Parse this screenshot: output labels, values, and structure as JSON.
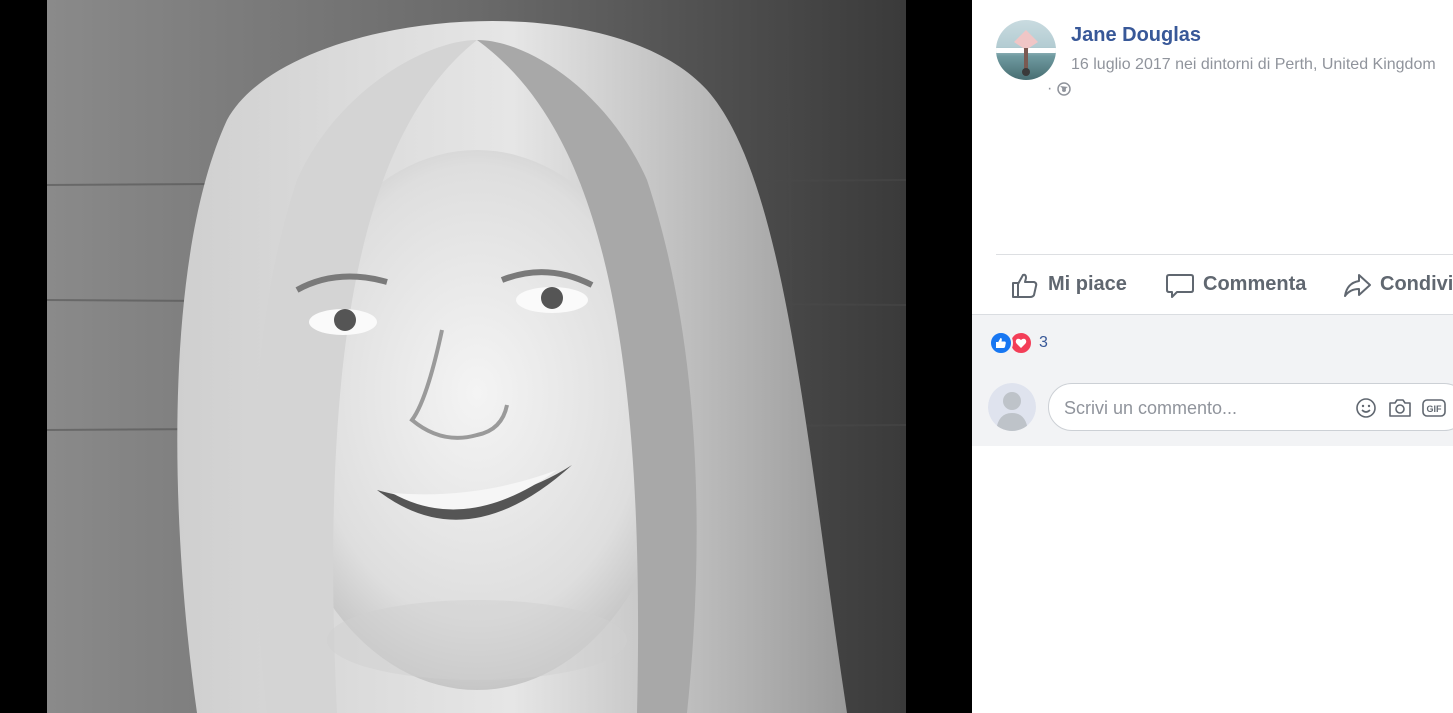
{
  "post": {
    "author": "Jane Douglas",
    "meta": "16 luglio 2017 nei dintorni di Perth, United Kingdom",
    "meta_sep": "·",
    "privacy_icon": "globe-icon"
  },
  "actions": {
    "like": "Mi piace",
    "comment": "Commenta",
    "share": "Condividi"
  },
  "reactions": {
    "types": [
      "like-icon",
      "love-icon"
    ],
    "count": "3"
  },
  "comment_input": {
    "placeholder": "Scrivi un commento...",
    "icons": [
      "emoji-icon",
      "camera-icon",
      "gif-icon"
    ],
    "gif_label": "GIF"
  },
  "colors": {
    "link": "#385898",
    "meta": "#90949c",
    "like": "#1877f2",
    "love": "#f33e58"
  }
}
